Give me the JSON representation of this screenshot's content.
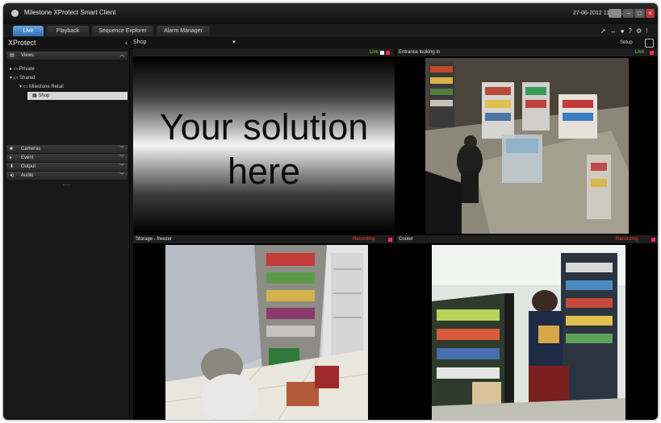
{
  "window": {
    "title": "Milestone XProtect Smart Client",
    "clock": "27-06-2012 11:07:12"
  },
  "tabs": [
    {
      "label": "Live",
      "active": true
    },
    {
      "label": "Playback",
      "active": false
    },
    {
      "label": "Sequence Explorer",
      "active": false
    },
    {
      "label": "Alarm Manager",
      "active": false
    }
  ],
  "header": {
    "product": "XProtect",
    "view_name": "Shop",
    "setup_label": "Setup"
  },
  "sidebar": {
    "views_title": "Views",
    "tree": [
      {
        "label": "Private",
        "level": 0,
        "selected": false
      },
      {
        "label": "Shared",
        "level": 0,
        "selected": false
      },
      {
        "label": "Milestone Retail",
        "level": 1,
        "selected": false
      },
      {
        "label": "Shop",
        "level": 2,
        "selected": true
      }
    ],
    "panes": [
      {
        "label": "Cameras",
        "icon": "camera-icon"
      },
      {
        "label": "Event",
        "icon": "play-icon"
      },
      {
        "label": "Output",
        "icon": "output-icon"
      },
      {
        "label": "Audio",
        "icon": "speaker-icon"
      }
    ]
  },
  "cells": {
    "top_left": {
      "status": "Live",
      "placeholder": "Your solution here"
    },
    "top_right": {
      "name": "Entrance looking in",
      "status": "Live"
    },
    "bottom_left": {
      "name": "Storage - freezer",
      "status": "Recording"
    },
    "bottom_right": {
      "name": "Cooler",
      "status": "Recording"
    }
  },
  "colors": {
    "live": "#7ed321",
    "recording": "#ff3b30",
    "active_tab": "#2f6fb5"
  }
}
